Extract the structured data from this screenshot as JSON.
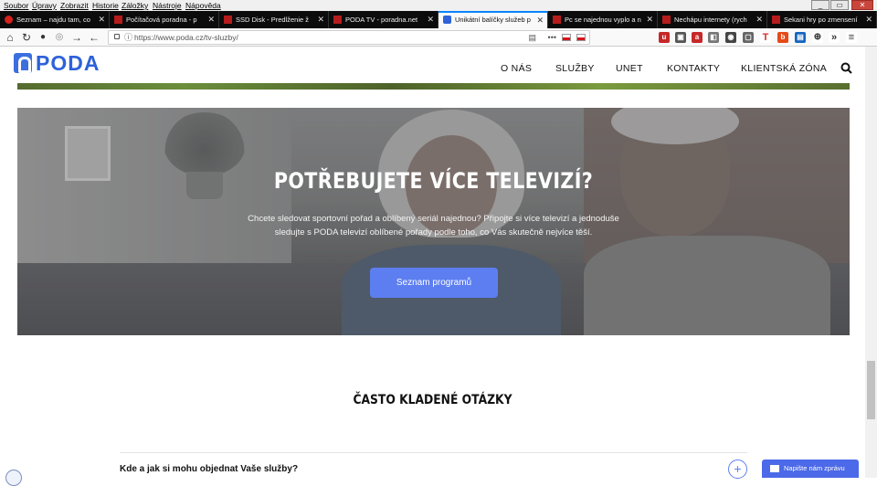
{
  "menubar": {
    "items": [
      "Soubor",
      "Úpravy",
      "Zobrazit",
      "Historie",
      "Záložky",
      "Nástroje",
      "Nápověda"
    ]
  },
  "tabs": [
    {
      "label": "Seznam – najdu tam, co",
      "favicon_color": "#d6211c",
      "active": false
    },
    {
      "label": "Počítačová poradna - p",
      "favicon_color": "#b71c1c",
      "active": false
    },
    {
      "label": "SSD Disk - Predlženie ž",
      "favicon_color": "#b71c1c",
      "active": false
    },
    {
      "label": "PODA TV - poradna.net",
      "favicon_color": "#b71c1c",
      "active": false
    },
    {
      "label": "Unikátní balíčky služeb p",
      "favicon_color": "#2e62d9",
      "active": true
    },
    {
      "label": "Pc se najednou vyplo a n",
      "favicon_color": "#b71c1c",
      "active": false
    },
    {
      "label": "Nechápu internety (rych",
      "favicon_color": "#b71c1c",
      "active": false
    },
    {
      "label": "Sekani hry po zmensení",
      "favicon_color": "#b71c1c",
      "active": false
    }
  ],
  "browser": {
    "url": "https://www.poda.cz/tv-sluzby/",
    "url_domain": "www.poda.cz",
    "url_path": "/tv-sluzby/"
  },
  "site": {
    "logo_text": "PODA",
    "nav": [
      "O NÁS",
      "SLUŽBY",
      "UNET",
      "KONTAKTY",
      "KLIENTSKÁ ZÓNA"
    ],
    "accent": "#5d7ef0"
  },
  "hero": {
    "title": "POTŘEBUJETE VÍCE TELEVIZÍ?",
    "text_line1": "Chcete sledovat sportovní pořad a oblíbený seriál najednou? Připojte si více televizí a jednoduše",
    "text_line2": "sledujte s PODA televizí oblíbené pořady podle toho, co Vás skutečně nejvíce těší.",
    "button": "Seznam programů"
  },
  "faq": {
    "title": "ČASTO KLADENÉ OTÁZKY",
    "questions": [
      "Kde a jak si mohu objednat Vaše služby?"
    ]
  },
  "chat": {
    "label": "Napište nám zprávu"
  }
}
